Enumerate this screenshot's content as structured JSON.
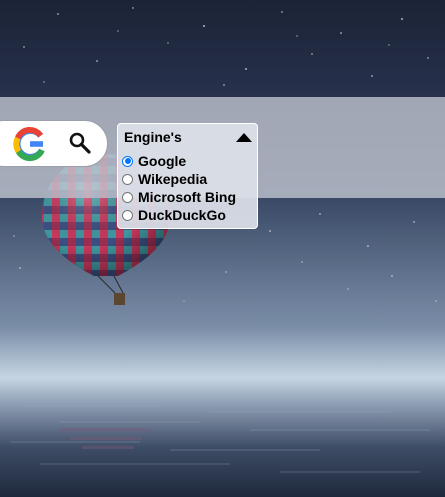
{
  "search": {
    "logo_icon": "google-g-logo-icon",
    "search_icon": "magnifier-icon"
  },
  "engine_panel": {
    "title": "Engine's",
    "collapse_icon": "triangle-up-icon",
    "options": [
      {
        "label": "Google",
        "selected": true
      },
      {
        "label": "Wikepedia",
        "selected": false
      },
      {
        "label": "Microsoft Bing",
        "selected": false
      },
      {
        "label": "DuckDuckGo",
        "selected": false
      }
    ]
  },
  "colors": {
    "radio_accent": "#0075ff",
    "google_blue": "#4285F4",
    "google_red": "#EA4335",
    "google_yellow": "#FBBC05",
    "google_green": "#34A853"
  }
}
